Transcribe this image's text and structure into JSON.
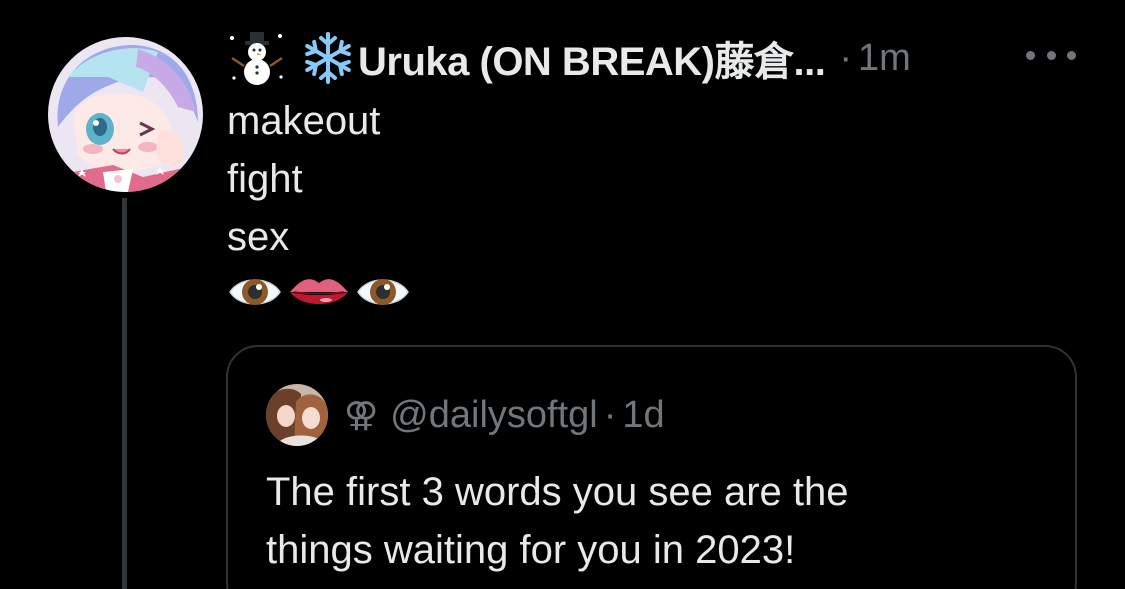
{
  "author": {
    "display_name": "Uruka (ON BREAK)藤倉...",
    "separator": "·",
    "time": "1m"
  },
  "tweet": {
    "lines": [
      "makeout",
      "fight",
      "sex"
    ]
  },
  "quote": {
    "symbol": "⚢",
    "handle": "@dailysoftgl",
    "separator": "·",
    "time": "1d",
    "text_lines": [
      "The first 3 words you see are the",
      "things waiting for you in 2023!"
    ]
  },
  "icons": {
    "prefix_1": "snowman-icon",
    "prefix_2": "snowflake-icon",
    "emoji_row": [
      "eye-icon",
      "lips-icon",
      "eye-icon"
    ],
    "more": "more-options-icon"
  },
  "colors": {
    "background": "#000000",
    "primary_text": "#e7e9ea",
    "secondary_text": "#71767b",
    "border": "#2f3336",
    "thread_line": "#333639"
  }
}
